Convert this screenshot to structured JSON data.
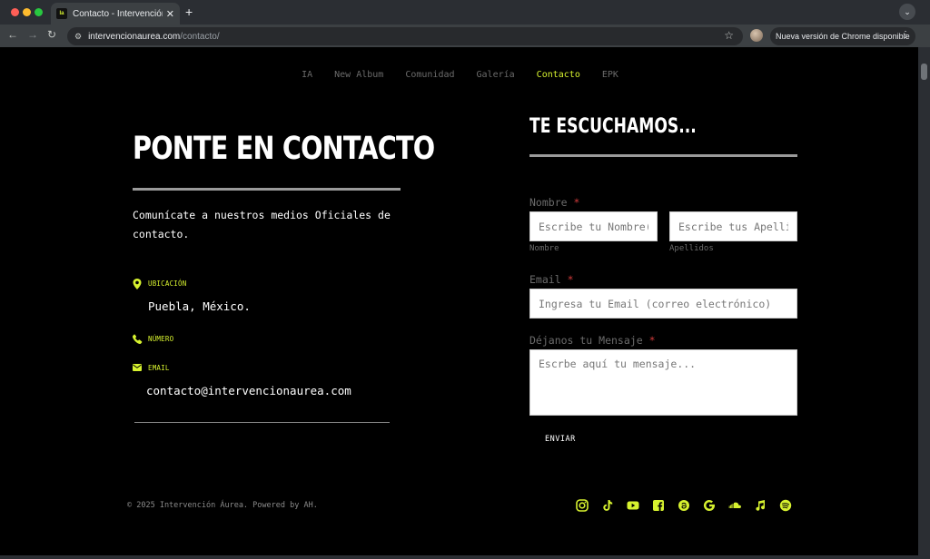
{
  "browser": {
    "tab_title": "Contacto - Intervención Áurea",
    "favicon_text": "Ia",
    "url_host": "intervencionaurea.com",
    "url_path": "/contacto/",
    "update_text": "Nueva versión de Chrome disponible"
  },
  "nav": {
    "items": [
      {
        "label": "IA"
      },
      {
        "label": "New Album"
      },
      {
        "label": "Comunidad"
      },
      {
        "label": "Galería"
      },
      {
        "label": "Contacto"
      },
      {
        "label": "EPK"
      }
    ]
  },
  "contact": {
    "heading": "PONTE EN CONTACTO",
    "intro": "Comunícate a nuestros medios Oficiales de contacto.",
    "location_label": "UBICACIÓN",
    "location_value": "Puebla, México.",
    "phone_label": "NÚMERO",
    "email_label": "EMAIL",
    "email_value": "contacto@intervencionaurea.com"
  },
  "form": {
    "heading": "TE ESCUCHAMOS...",
    "name_label": "Nombre",
    "required_mark": "*",
    "first_name_placeholder": "Escribe tu Nombre(s)",
    "last_name_placeholder": "Escribe tus Apellidos",
    "first_name_sublabel": "Nombre",
    "last_name_sublabel": "Apellidos",
    "email_label": "Email",
    "email_placeholder": "Ingresa tu Email (correo electrónico)",
    "message_label": "Déjanos tu Mensaje",
    "message_placeholder": "Escrbe aquí tu mensaje...",
    "send_label": "ENVIAR"
  },
  "footer": {
    "copyright": "© 2025 Intervención Áurea. Powered by AH.",
    "socials": [
      "instagram-icon",
      "tiktok-icon",
      "youtube-icon",
      "facebook-icon",
      "threads-icon",
      "google-icon",
      "soundcloud-icon",
      "music-note-icon",
      "spotify-icon"
    ]
  },
  "colors": {
    "accent": "#d7f22f",
    "background": "#000000",
    "required": "#d13b3b"
  }
}
